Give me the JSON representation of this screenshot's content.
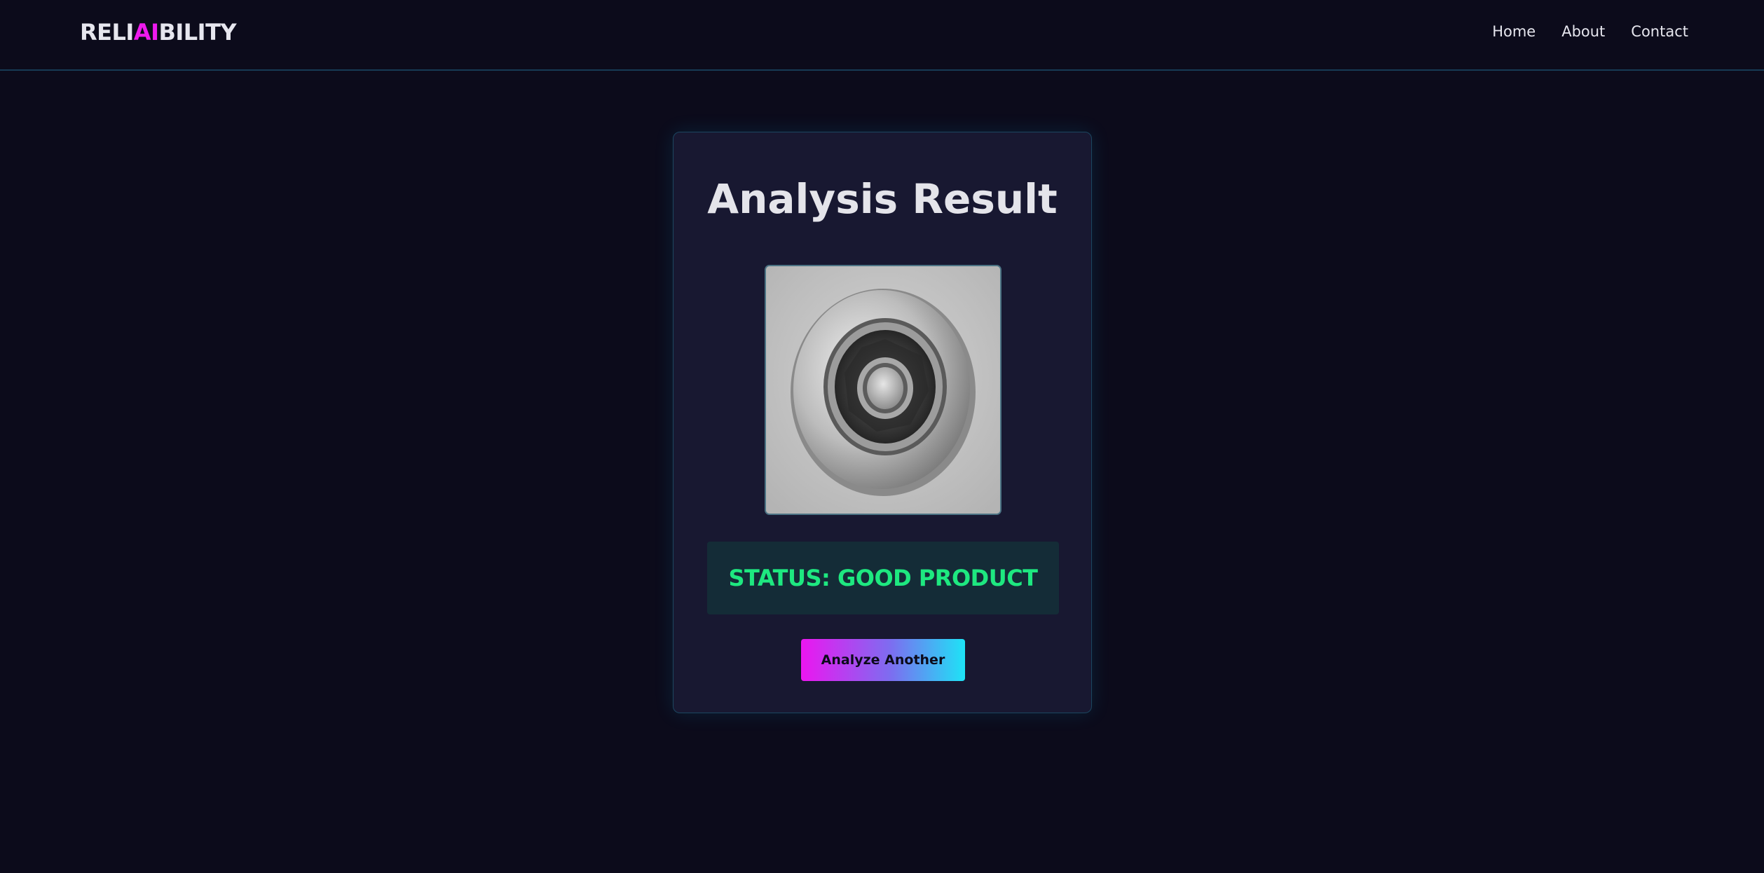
{
  "header": {
    "logo": {
      "part1": "RELI",
      "part2": "AI",
      "part3": "BILITY"
    },
    "nav": [
      {
        "label": "Home"
      },
      {
        "label": "About"
      },
      {
        "label": "Contact"
      }
    ]
  },
  "result": {
    "title": "Analysis Result",
    "image_subject": "metal-casting-impeller",
    "status": "STATUS: GOOD PRODUCT",
    "button_label": "Analyze Another"
  },
  "colors": {
    "background": "#0c0b1b",
    "card": "#181831",
    "accent_magenta": "#ee1aee",
    "accent_cyan": "#1ee3f6",
    "status_good": "#1ee880"
  }
}
